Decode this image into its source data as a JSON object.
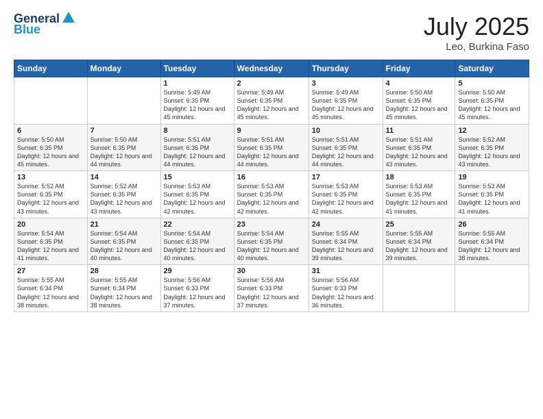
{
  "header": {
    "logo_line1": "General",
    "logo_line2": "Blue",
    "title": "July 2025",
    "location": "Leo, Burkina Faso"
  },
  "days_of_week": [
    "Sunday",
    "Monday",
    "Tuesday",
    "Wednesday",
    "Thursday",
    "Friday",
    "Saturday"
  ],
  "weeks": [
    [
      {
        "day": "",
        "info": ""
      },
      {
        "day": "",
        "info": ""
      },
      {
        "day": "1",
        "info": "Sunrise: 5:49 AM\nSunset: 6:35 PM\nDaylight: 12 hours and 45 minutes."
      },
      {
        "day": "2",
        "info": "Sunrise: 5:49 AM\nSunset: 6:35 PM\nDaylight: 12 hours and 45 minutes."
      },
      {
        "day": "3",
        "info": "Sunrise: 5:49 AM\nSunset: 6:35 PM\nDaylight: 12 hours and 45 minutes."
      },
      {
        "day": "4",
        "info": "Sunrise: 5:50 AM\nSunset: 6:35 PM\nDaylight: 12 hours and 45 minutes."
      },
      {
        "day": "5",
        "info": "Sunrise: 5:50 AM\nSunset: 6:35 PM\nDaylight: 12 hours and 45 minutes."
      }
    ],
    [
      {
        "day": "6",
        "info": "Sunrise: 5:50 AM\nSunset: 6:35 PM\nDaylight: 12 hours and 45 minutes."
      },
      {
        "day": "7",
        "info": "Sunrise: 5:50 AM\nSunset: 6:35 PM\nDaylight: 12 hours and 44 minutes."
      },
      {
        "day": "8",
        "info": "Sunrise: 5:51 AM\nSunset: 6:35 PM\nDaylight: 12 hours and 44 minutes."
      },
      {
        "day": "9",
        "info": "Sunrise: 5:51 AM\nSunset: 6:35 PM\nDaylight: 12 hours and 44 minutes."
      },
      {
        "day": "10",
        "info": "Sunrise: 5:51 AM\nSunset: 6:35 PM\nDaylight: 12 hours and 44 minutes."
      },
      {
        "day": "11",
        "info": "Sunrise: 5:51 AM\nSunset: 6:35 PM\nDaylight: 12 hours and 43 minutes."
      },
      {
        "day": "12",
        "info": "Sunrise: 5:52 AM\nSunset: 6:35 PM\nDaylight: 12 hours and 43 minutes."
      }
    ],
    [
      {
        "day": "13",
        "info": "Sunrise: 5:52 AM\nSunset: 6:35 PM\nDaylight: 12 hours and 43 minutes."
      },
      {
        "day": "14",
        "info": "Sunrise: 5:52 AM\nSunset: 6:35 PM\nDaylight: 12 hours and 43 minutes."
      },
      {
        "day": "15",
        "info": "Sunrise: 5:53 AM\nSunset: 6:35 PM\nDaylight: 12 hours and 42 minutes."
      },
      {
        "day": "16",
        "info": "Sunrise: 5:53 AM\nSunset: 6:35 PM\nDaylight: 12 hours and 42 minutes."
      },
      {
        "day": "17",
        "info": "Sunrise: 5:53 AM\nSunset: 6:35 PM\nDaylight: 12 hours and 42 minutes."
      },
      {
        "day": "18",
        "info": "Sunrise: 5:53 AM\nSunset: 6:35 PM\nDaylight: 12 hours and 41 minutes."
      },
      {
        "day": "19",
        "info": "Sunrise: 5:53 AM\nSunset: 6:35 PM\nDaylight: 12 hours and 41 minutes."
      }
    ],
    [
      {
        "day": "20",
        "info": "Sunrise: 5:54 AM\nSunset: 6:35 PM\nDaylight: 12 hours and 41 minutes."
      },
      {
        "day": "21",
        "info": "Sunrise: 5:54 AM\nSunset: 6:35 PM\nDaylight: 12 hours and 40 minutes."
      },
      {
        "day": "22",
        "info": "Sunrise: 5:54 AM\nSunset: 6:35 PM\nDaylight: 12 hours and 40 minutes."
      },
      {
        "day": "23",
        "info": "Sunrise: 5:54 AM\nSunset: 6:35 PM\nDaylight: 12 hours and 40 minutes."
      },
      {
        "day": "24",
        "info": "Sunrise: 5:55 AM\nSunset: 6:34 PM\nDaylight: 12 hours and 39 minutes."
      },
      {
        "day": "25",
        "info": "Sunrise: 5:55 AM\nSunset: 6:34 PM\nDaylight: 12 hours and 39 minutes."
      },
      {
        "day": "26",
        "info": "Sunrise: 5:55 AM\nSunset: 6:34 PM\nDaylight: 12 hours and 38 minutes."
      }
    ],
    [
      {
        "day": "27",
        "info": "Sunrise: 5:55 AM\nSunset: 6:34 PM\nDaylight: 12 hours and 38 minutes."
      },
      {
        "day": "28",
        "info": "Sunrise: 5:55 AM\nSunset: 6:34 PM\nDaylight: 12 hours and 38 minutes."
      },
      {
        "day": "29",
        "info": "Sunrise: 5:56 AM\nSunset: 6:33 PM\nDaylight: 12 hours and 37 minutes."
      },
      {
        "day": "30",
        "info": "Sunrise: 5:56 AM\nSunset: 6:33 PM\nDaylight: 12 hours and 37 minutes."
      },
      {
        "day": "31",
        "info": "Sunrise: 5:56 AM\nSunset: 6:33 PM\nDaylight: 12 hours and 36 minutes."
      },
      {
        "day": "",
        "info": ""
      },
      {
        "day": "",
        "info": ""
      }
    ]
  ]
}
